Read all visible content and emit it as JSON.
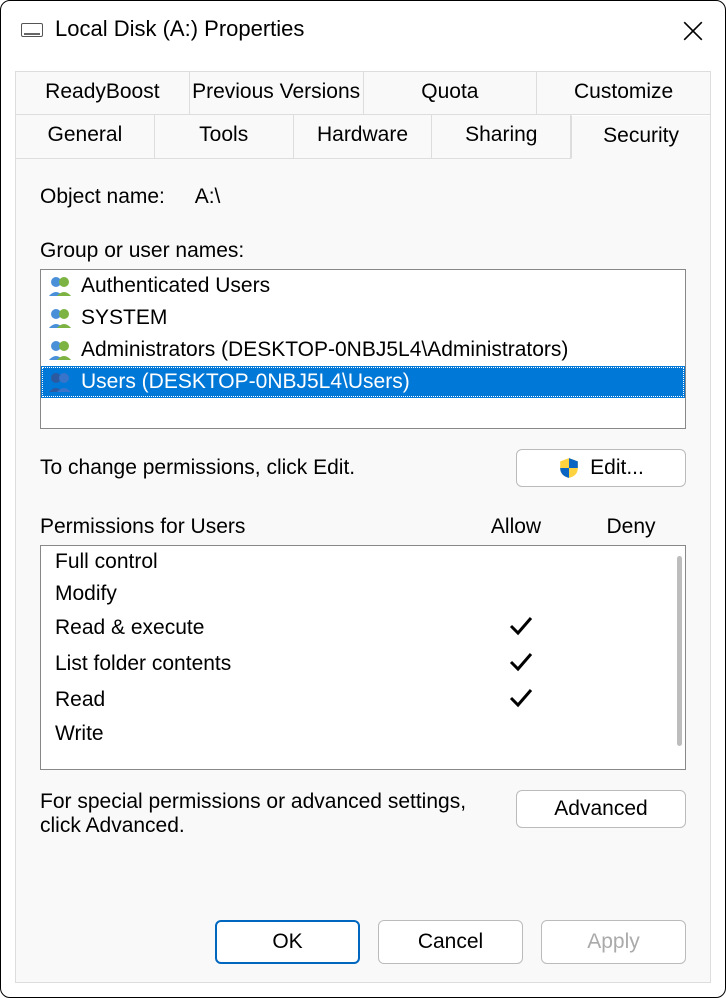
{
  "title": "Local Disk (A:) Properties",
  "tabs_row1": [
    {
      "label": "ReadyBoost"
    },
    {
      "label": "Previous Versions"
    },
    {
      "label": "Quota"
    },
    {
      "label": "Customize"
    }
  ],
  "tabs_row2": [
    {
      "label": "General"
    },
    {
      "label": "Tools"
    },
    {
      "label": "Hardware"
    },
    {
      "label": "Sharing"
    },
    {
      "label": "Security"
    }
  ],
  "object_name_label": "Object name:",
  "object_name_value": "A:\\",
  "group_label": "Group or user names:",
  "users": [
    {
      "label": "Authenticated Users"
    },
    {
      "label": "SYSTEM"
    },
    {
      "label": "Administrators (DESKTOP-0NBJ5L4\\Administrators)"
    },
    {
      "label": "Users (DESKTOP-0NBJ5L4\\Users)"
    }
  ],
  "edit_hint": "To change permissions, click Edit.",
  "edit_button": "Edit...",
  "perm_for": "Permissions for Users",
  "allow": "Allow",
  "deny": "Deny",
  "permissions": [
    {
      "name": "Full control",
      "allow": false
    },
    {
      "name": "Modify",
      "allow": false
    },
    {
      "name": "Read & execute",
      "allow": true
    },
    {
      "name": "List folder contents",
      "allow": true
    },
    {
      "name": "Read",
      "allow": true
    },
    {
      "name": "Write",
      "allow": false
    }
  ],
  "advanced_hint": "For special permissions or advanced settings, click Advanced.",
  "advanced_button": "Advanced",
  "ok": "OK",
  "cancel": "Cancel",
  "apply": "Apply"
}
